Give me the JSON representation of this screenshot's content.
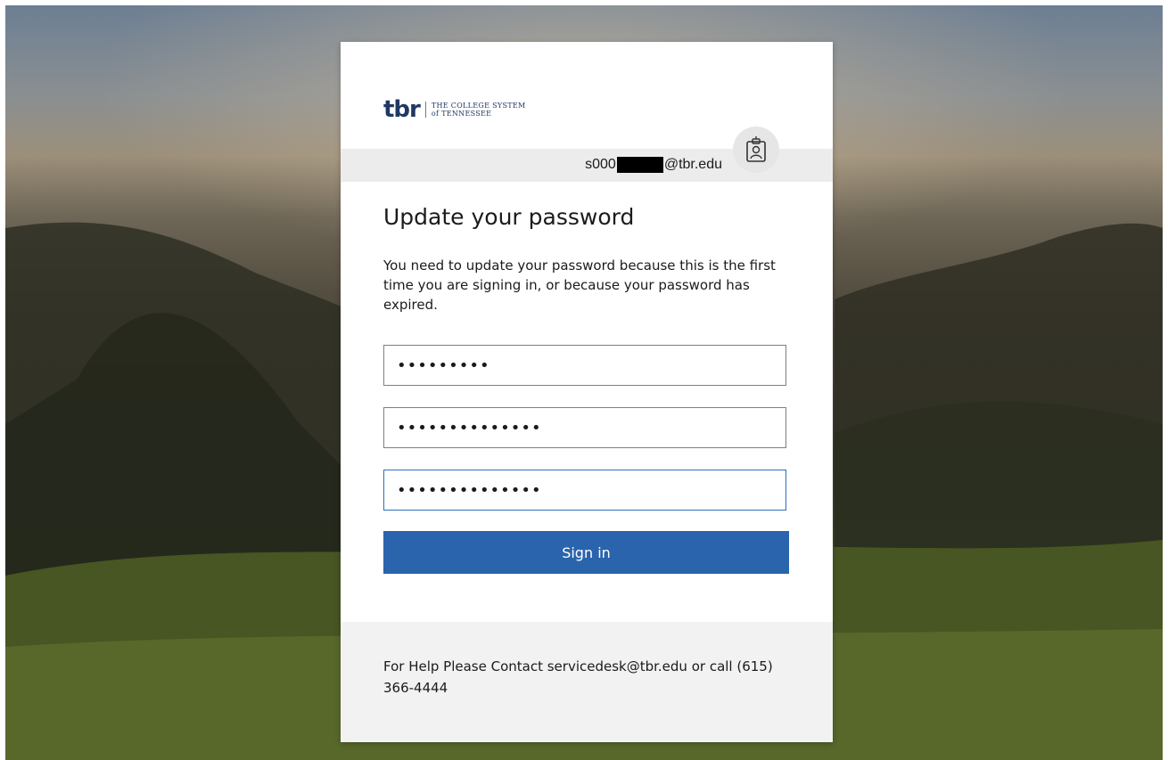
{
  "colors": {
    "brand_navy": "#1f3864",
    "brand_red": "#c8102e",
    "primary_button": "#2a64ad",
    "focus_border": "#2c6fb8"
  },
  "header": {
    "logo_mark": "tbr",
    "logo_line1": "THE COLLEGE SYSTEM",
    "logo_line2": "of TENNESSEE"
  },
  "identity": {
    "email_prefix": "s000",
    "email_suffix": "@tbr.edu",
    "badge_icon": "id-badge-icon"
  },
  "main": {
    "title": "Update your password",
    "description": "You need to update your password because this is the first time you are signing in, or because your password has expired.",
    "fields": [
      {
        "value": "•••••••••"
      },
      {
        "value": "••••••••••••••"
      },
      {
        "value": "••••••••••••••"
      }
    ],
    "signin_label": "Sign in"
  },
  "footer": {
    "help_text": "For Help Please Contact servicedesk@tbr.edu or call (615) 366-4444"
  }
}
